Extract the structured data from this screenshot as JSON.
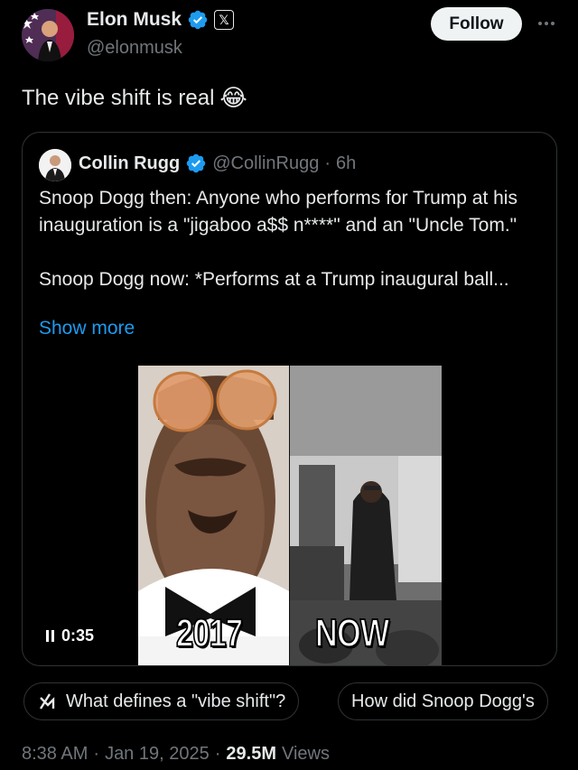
{
  "author": {
    "name": "Elon Musk",
    "handle": "@elonmusk",
    "badge_icon": "x-affiliate-icon"
  },
  "actions": {
    "follow_label": "Follow",
    "more_icon": "more-horizontal-icon"
  },
  "post": {
    "text": "The vibe shift is real",
    "emoji": "😂"
  },
  "quoted": {
    "name": "Collin Rugg",
    "handle": "@CollinRugg",
    "separator": "·",
    "time": "6h",
    "line1": "Snoop Dogg then: Anyone who performs for Trump at his inauguration is a \"jigaboo a$$ n****\" and an \"Uncle Tom.\"",
    "line2": "Snoop Dogg now: *Performs at a Trump inaugural ball...",
    "show_more": "Show more",
    "video": {
      "duration": "0:35",
      "caption_left": "2017",
      "caption_right": "NOW"
    }
  },
  "grok_chips": [
    {
      "label": "What defines a \"vibe shift\"?",
      "icon": "grok-icon"
    },
    {
      "label": "How did Snoop Dogg's"
    }
  ],
  "meta": {
    "time": "8:38 AM",
    "sep1": "·",
    "date": "Jan 19, 2025",
    "sep2": "·",
    "views_count": "29.5M",
    "views_label": "Views"
  },
  "colors": {
    "background": "#000000",
    "verified": "#1d9bf0",
    "link": "#1d9bf0",
    "secondary_text": "#71767b"
  }
}
